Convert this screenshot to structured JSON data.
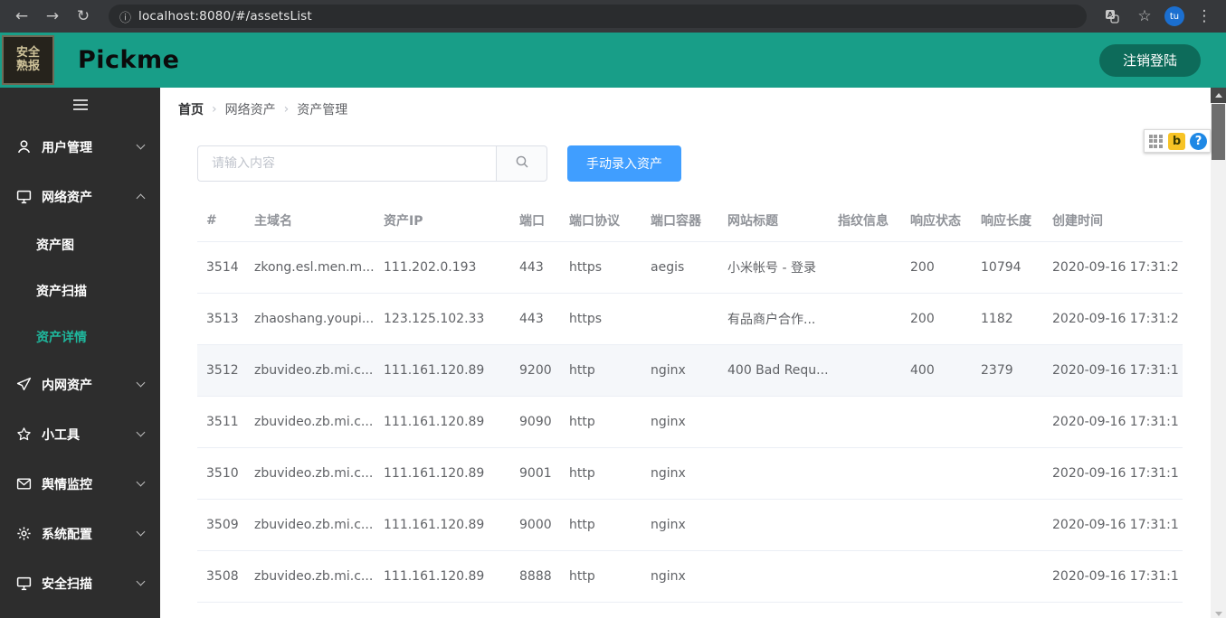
{
  "browser": {
    "url": "localhost:8080/#/assetsList",
    "avatar": "tu"
  },
  "header": {
    "brand": "Pickme",
    "logo_line1": "安全",
    "logo_line2": "熟报",
    "logout_label": "注销登陆"
  },
  "sidebar": {
    "items": [
      {
        "id": "users",
        "label": "用户管理",
        "icon": "user",
        "expanded": false
      },
      {
        "id": "network-assets",
        "label": "网络资产",
        "icon": "monitor",
        "expanded": true,
        "children": [
          {
            "id": "asset-map",
            "label": "资产图",
            "active": false
          },
          {
            "id": "asset-scan",
            "label": "资产扫描",
            "active": false
          },
          {
            "id": "asset-detail",
            "label": "资产详情",
            "active": true
          }
        ]
      },
      {
        "id": "intranet-assets",
        "label": "内网资产",
        "icon": "send",
        "expanded": false
      },
      {
        "id": "tools",
        "label": "小工具",
        "icon": "star",
        "expanded": false
      },
      {
        "id": "opinion-monitor",
        "label": "舆情监控",
        "icon": "mail",
        "expanded": false
      },
      {
        "id": "system-config",
        "label": "系统配置",
        "icon": "gear",
        "expanded": false
      },
      {
        "id": "security-scan",
        "label": "安全扫描",
        "icon": "scan",
        "expanded": false
      }
    ]
  },
  "breadcrumb": [
    "首页",
    "网络资产",
    "资产管理"
  ],
  "toolbar": {
    "search_placeholder": "请输入内容",
    "add_button": "手动录入资产"
  },
  "table": {
    "columns": [
      "#",
      "主域名",
      "资产IP",
      "端口",
      "端口协议",
      "端口容器",
      "网站标题",
      "指纹信息",
      "响应状态",
      "响应长度",
      "创建时间"
    ],
    "highlighted_row_index": 2,
    "rows": [
      [
        "3514",
        "zkong.esl.men.m...",
        "111.202.0.193",
        "443",
        "https",
        "aegis",
        "小米帐号 - 登录",
        "",
        "200",
        "10794",
        "2020-09-16 17:31:2"
      ],
      [
        "3513",
        "zhaoshang.youpi...",
        "123.125.102.33",
        "443",
        "https",
        "",
        "有品商户合作...",
        "",
        "200",
        "1182",
        "2020-09-16 17:31:2"
      ],
      [
        "3512",
        "zbuvideo.zb.mi.c...",
        "111.161.120.89",
        "9200",
        "http",
        "nginx",
        "400 Bad Requ...",
        "",
        "400",
        "2379",
        "2020-09-16 17:31:1"
      ],
      [
        "3511",
        "zbuvideo.zb.mi.c...",
        "111.161.120.89",
        "9090",
        "http",
        "nginx",
        "",
        "",
        "",
        "",
        "2020-09-16 17:31:1"
      ],
      [
        "3510",
        "zbuvideo.zb.mi.c...",
        "111.161.120.89",
        "9001",
        "http",
        "nginx",
        "",
        "",
        "",
        "",
        "2020-09-16 17:31:1"
      ],
      [
        "3509",
        "zbuvideo.zb.mi.c...",
        "111.161.120.89",
        "9000",
        "http",
        "nginx",
        "",
        "",
        "",
        "",
        "2020-09-16 17:31:1"
      ],
      [
        "3508",
        "zbuvideo.zb.mi.c...",
        "111.161.120.89",
        "8888",
        "http",
        "nginx",
        "",
        "",
        "",
        "",
        "2020-09-16 17:31:1"
      ]
    ]
  },
  "float_toolbar": {
    "badge": "b",
    "help": "?"
  },
  "theme": {
    "header_teal": "#189e88",
    "logout_green": "#0d6b5a",
    "sidebar_dark": "#2d2d2d",
    "active_menu_teal": "#1fb79d",
    "primary_blue": "#409eff"
  }
}
